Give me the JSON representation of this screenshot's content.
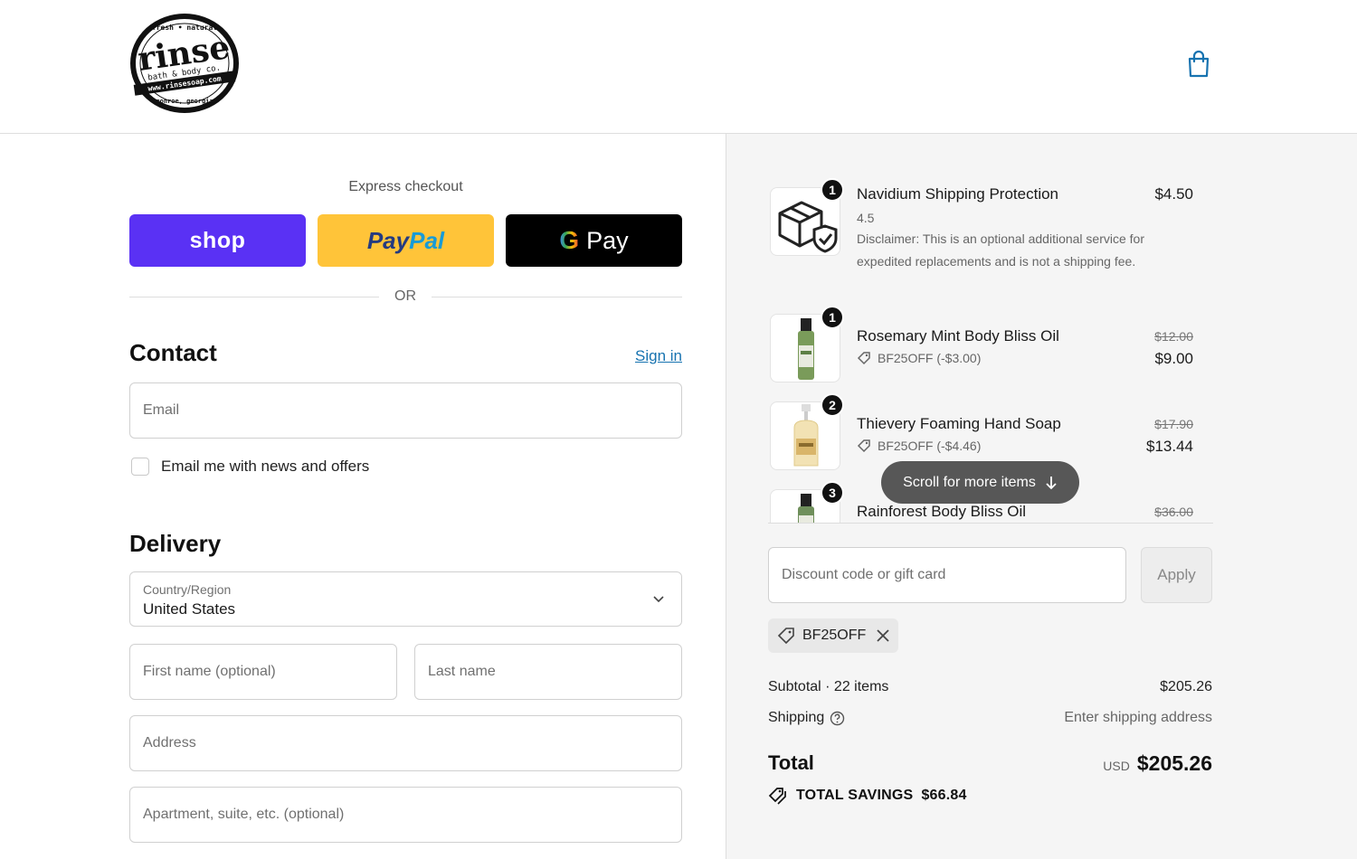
{
  "header": {
    "logo_text": {
      "arc_top": "fresh • natural",
      "main": "rinse",
      "line1": "bath & body co.",
      "line2": "www.rinsesoap.com",
      "arc_bottom": "monroe, georgia"
    },
    "cart_icon": "shopping-bag-icon"
  },
  "express": {
    "title": "Express checkout",
    "shop_label": "shop",
    "paypal_label_1": "Pay",
    "paypal_label_2": "Pal",
    "gpay_g": "G",
    "gpay_label": "Pay",
    "or_label": "OR"
  },
  "contact": {
    "title": "Contact",
    "signin_label": "Sign in",
    "email_placeholder": "Email",
    "newsletter_label": "Email me with news and offers"
  },
  "delivery": {
    "title": "Delivery",
    "country_label": "Country/Region",
    "country_value": "United States",
    "first_name_placeholder": "First name (optional)",
    "last_name_placeholder": "Last name",
    "address_placeholder": "Address",
    "apartment_placeholder": "Apartment, suite, etc. (optional)"
  },
  "order": {
    "items": [
      {
        "qty": "1",
        "name": "Navidium Shipping Protection",
        "sub": "4.5",
        "desc": "Disclaimer: This is an optional additional service for expedited replacements and is not a shipping fee.",
        "price": "$4.50"
      },
      {
        "qty": "1",
        "name": "Rosemary Mint Body Bliss Oil",
        "discount": "BF25OFF (-$3.00)",
        "old_price": "$12.00",
        "price": "$9.00"
      },
      {
        "qty": "2",
        "name": "Thievery Foaming Hand Soap",
        "discount": "BF25OFF (-$4.46)",
        "old_price": "$17.90",
        "price": "$13.44"
      },
      {
        "qty": "3",
        "name": "Rainforest Body Bliss Oil",
        "old_price": "$36.00"
      }
    ],
    "scroll_label": "Scroll for more items",
    "discount_placeholder": "Discount code or gift card",
    "apply_label": "Apply",
    "applied_code": "BF25OFF",
    "subtotal_label": "Subtotal · 22 items",
    "subtotal_value": "$205.26",
    "shipping_label": "Shipping",
    "shipping_value": "Enter shipping address",
    "total_label": "Total",
    "total_currency": "USD",
    "total_value": "$205.26",
    "savings_label": "TOTAL SAVINGS",
    "savings_value": "$66.84"
  },
  "colors": {
    "shop_purple": "#5a31f4",
    "paypal_yellow": "#ffc439",
    "link_blue": "#1773b0",
    "right_panel_bg": "#f5f5f5"
  }
}
